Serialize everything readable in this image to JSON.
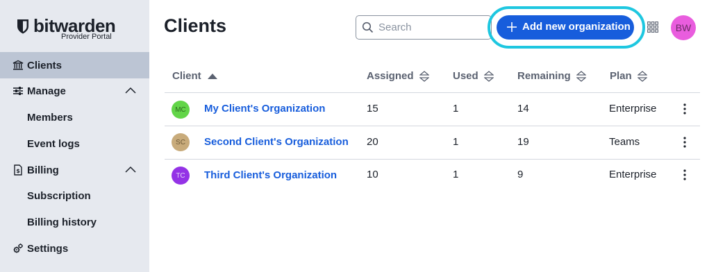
{
  "brand": {
    "name": "bitwarden",
    "subtitle": "Provider Portal"
  },
  "sidebar": {
    "items": [
      {
        "label": "Clients",
        "icon": "bank-icon",
        "active": true
      },
      {
        "label": "Manage",
        "icon": "sliders-icon",
        "expanded": true
      },
      {
        "label": "Members",
        "sub": true
      },
      {
        "label": "Event logs",
        "sub": true
      },
      {
        "label": "Billing",
        "icon": "billing-icon",
        "expanded": true
      },
      {
        "label": "Subscription",
        "sub": true
      },
      {
        "label": "Billing history",
        "sub": true
      },
      {
        "label": "Settings",
        "icon": "cogs-icon"
      }
    ]
  },
  "header": {
    "title": "Clients",
    "search_placeholder": "Search",
    "add_button_label": "Add new organization",
    "user_initials": "BW"
  },
  "table": {
    "columns": [
      "Client",
      "Assigned",
      "Used",
      "Remaining",
      "Plan"
    ],
    "rows": [
      {
        "initials": "MC",
        "avatar_color": "#62d548",
        "name": "My Client's Organization",
        "assigned": "15",
        "used": "1",
        "remaining": "14",
        "plan": "Enterprise"
      },
      {
        "initials": "SC",
        "avatar_color": "#c8ab7b",
        "name": "Second Client's Organization",
        "assigned": "20",
        "used": "1",
        "remaining": "19",
        "plan": "Teams"
      },
      {
        "initials": "TC",
        "avatar_color": "#9433e6",
        "name": "Third Client's Organization",
        "assigned": "10",
        "used": "1",
        "remaining": "9",
        "plan": "Enterprise"
      }
    ]
  },
  "colors": {
    "accent": "#175ddc",
    "highlight": "#1ec7e0",
    "sidebar_bg": "#e6e9ef",
    "sidebar_active": "#bcc5d4"
  }
}
